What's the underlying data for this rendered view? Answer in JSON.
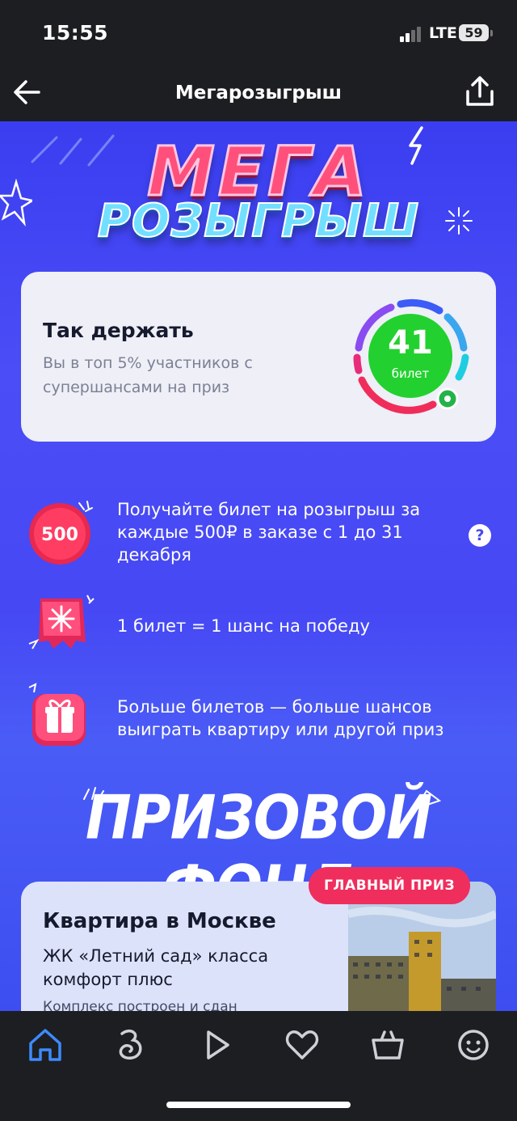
{
  "status_bar": {
    "time": "15:55",
    "network": "LTE",
    "battery": "59"
  },
  "nav": {
    "title": "Мегарозыгрыш",
    "back_icon": "arrow-left-icon",
    "share_icon": "share-icon"
  },
  "hero": {
    "line1": "МЕГА",
    "line2": "РОЗЫГРЫШ"
  },
  "stats": {
    "title": "Так держать",
    "text": "Вы в топ 5% участников с супершансами на приз",
    "tickets_count": "41",
    "tickets_word": "билет"
  },
  "rules": [
    {
      "icon": "500-coin-icon",
      "badge": "500",
      "text": "Получайте билет на розыгрыш за каждые 500₽ в заказе с 1 до 31 декабря"
    },
    {
      "icon": "ticket-icon",
      "text": "1 билет = 1 шанс на победу"
    },
    {
      "icon": "gift-icon",
      "text": "Больше билетов — больше шансов выиграть квартиру или другой приз"
    }
  ],
  "help_label": "?",
  "prize_fund": {
    "heading": "ПРИЗОВОЙ ФОНД"
  },
  "main_prize": {
    "badge": "ГЛАВНЫЙ ПРИЗ",
    "title": "Квартира в Москве",
    "subtitle": "ЖК «Летний сад» класса комфорт плюс",
    "bullet": "Комплекс построен и сдан"
  },
  "tabs": [
    "home-icon",
    "catalog-icon",
    "play-icon",
    "heart-icon",
    "basket-icon",
    "profile-icon"
  ],
  "colors": {
    "accent_blue": "#4648f4",
    "badge_red": "#ef2e5e",
    "ticket_green": "#22d12f",
    "card_bg": "#eeeff7"
  }
}
